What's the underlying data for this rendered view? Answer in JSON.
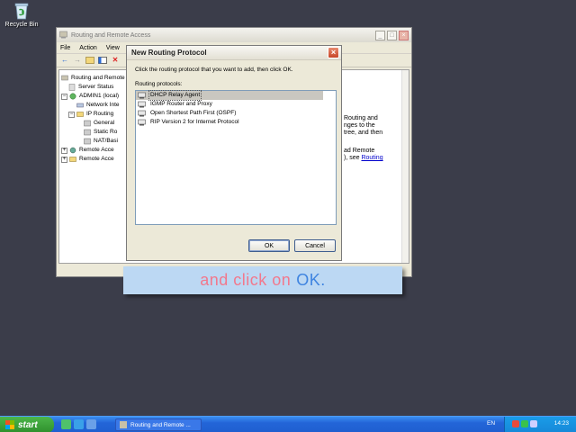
{
  "desktop": {
    "recycle_label": "Recycle Bin"
  },
  "mmc": {
    "title": "Routing and Remote Access",
    "menu": [
      "File",
      "Action",
      "View"
    ],
    "tree": [
      {
        "label": "Routing and Remote",
        "exp": ""
      },
      {
        "label": "Server Status",
        "exp": ""
      },
      {
        "label": "ADMIN1 (local)",
        "exp": "−"
      },
      {
        "label": "Network Inte",
        "exp": ""
      },
      {
        "label": "IP Routing",
        "exp": "−"
      },
      {
        "label": "General",
        "exp": ""
      },
      {
        "label": "Static Ro",
        "exp": ""
      },
      {
        "label": "NAT/Basi",
        "exp": ""
      },
      {
        "label": "Remote Acce",
        "exp": "+"
      },
      {
        "label": "Remote Acce",
        "exp": "+"
      }
    ],
    "right_text": {
      "l1": "Routing and",
      "l2": "nges to the",
      "l3": "tree, and then",
      "l4": "ad Remote",
      "l5": "), see",
      "link": "Routing"
    }
  },
  "dialog": {
    "title": "New Routing Protocol",
    "instruction": "Click the routing protocol that you want to add, then click OK.",
    "list_label": "Routing protocols:",
    "protocols": [
      "DHCP Relay Agent",
      "IGMP Router and Proxy",
      "Open Shortest Path First (OSPF)",
      "RIP Version 2 for Internet Protocol"
    ],
    "selected_index": 0,
    "ok_label": "OK",
    "cancel_label": "Cancel"
  },
  "caption": {
    "part1": "and click on",
    "part2": "OK."
  },
  "taskbar": {
    "start_label": "start",
    "task_label": "Routing and Remote ...",
    "lang": "EN",
    "clock": "14:23"
  },
  "colors": {
    "caption_bg": "#bcd8f3",
    "caption_text1": "#f2788c",
    "caption_text2": "#3f84e0",
    "taskbar": "#2365d8"
  }
}
